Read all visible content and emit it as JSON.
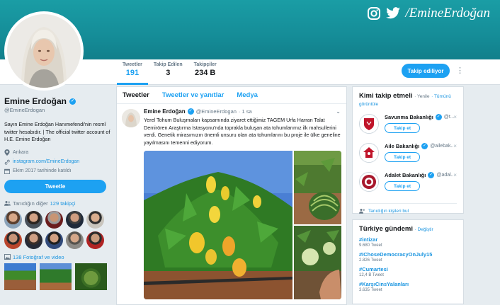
{
  "banner": {
    "handle": "/EmineErdoğan",
    "icons": [
      "instagram-icon",
      "twitter-bird-icon"
    ],
    "color": "#1a9da5"
  },
  "nav": {
    "stats": [
      {
        "label": "Tweetler",
        "value": "191"
      },
      {
        "label": "Takip Edilen",
        "value": "3"
      },
      {
        "label": "Takipçiler",
        "value": "234 B"
      }
    ],
    "follow_button": "Takip ediliyor"
  },
  "profile": {
    "name": "Emine Erdoğan",
    "handle": "@EmineErdogan",
    "bio": "Sayın Emine Erdoğan Hanımefendi'nin resmî twitter hesabıdır. | The official twitter account of H.E. Emine Erdoğan",
    "location": "Ankara",
    "website": "instagram.com/EmineErdogan",
    "joined": "Ekim 2017 tarihinde katıldı",
    "tweet_button": "Tweetle",
    "known_label": "Tanıdığın diğer",
    "known_count": "129 takipçi",
    "media_label": "138 Fotoğraf ve video"
  },
  "timeline": {
    "tabs": [
      "Tweetler",
      "Tweetler ve yanıtlar",
      "Medya"
    ],
    "tweet": {
      "name": "Emine Erdoğan",
      "handle": "@EmineErdogan",
      "time": "· 1 sa",
      "text": "Yerel Tohum Buluşmaları kapsamında ziyaret ettiğimiz TAGEM Urfa Harran Talat Demirören Araştırma İstasyonu'nda toprakla buluşan ata tohumlarımız ilk mahsullerini verdi. Genetik mirasımızın önemli unsuru olan ata tohumlarını bu proje ile ülke geneline yayılmasını temenni ediyorum."
    }
  },
  "who_to_follow": {
    "title": "Kimi takip etmeli",
    "refresh": "· Yenile",
    "all": "· Tümünü görüntüle",
    "suggestions": [
      {
        "name": "Savunma Bakanlığı",
        "handle": "@t...",
        "button": "Takip et"
      },
      {
        "name": "Aile Bakanlığı",
        "handle": "@ailebak...",
        "button": "Takip et"
      },
      {
        "name": "Adalet Bakanlığı",
        "handle": "@adal...",
        "button": "Takip et"
      }
    ],
    "find_people": "Tanıdığın kişileri bul"
  },
  "trends": {
    "title": "Türkiye gündemi",
    "change": "· Değiştir",
    "items": [
      {
        "tag": "#intizar",
        "count": "9.680 Tweet"
      },
      {
        "tag": "#IChoseDemocracyOnJuly15",
        "count": "2.826 Tweet"
      },
      {
        "tag": "#Cumartesi",
        "count": "12,4 B Tweet"
      },
      {
        "tag": "#KarşıCinsYalanları",
        "count": "3.635 Tweet"
      }
    ]
  },
  "colors": {
    "accent": "#1da1f2",
    "link": "#1b95e0",
    "banner": "#1a9da5"
  }
}
